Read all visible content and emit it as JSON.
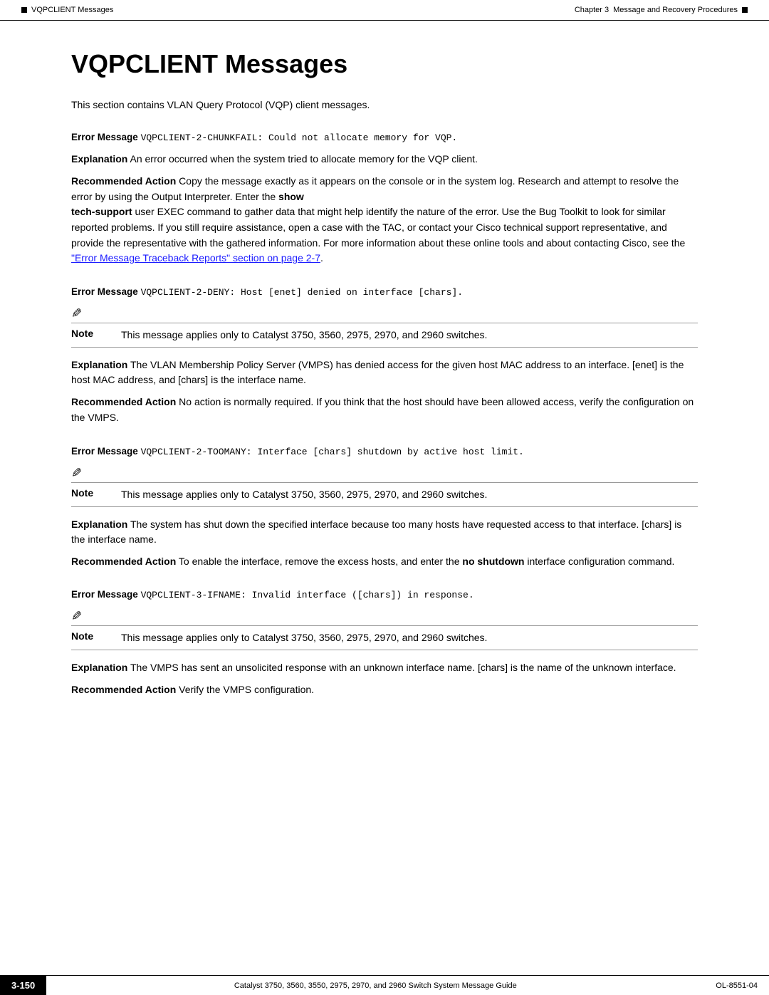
{
  "header": {
    "left_icon": "■",
    "left_label": "VQPCLIENT Messages",
    "chapter_label": "Chapter 3",
    "chapter_title": "Message and Recovery Procedures",
    "right_icon": "■"
  },
  "page_title": "VQPCLIENT Messages",
  "intro": "This section contains VLAN Query Protocol (VQP) client messages.",
  "sections": [
    {
      "id": "section1",
      "error_label": "Error Message",
      "error_code": "VQPCLIENT-2-CHUNKFAIL: Could not allocate memory for VQP.",
      "has_note": false,
      "explanation_label": "Explanation",
      "explanation_text": "An error occurred when the system tried to allocate memory for the VQP client.",
      "recommended_label": "Recommended Action",
      "recommended_text": "Copy the message exactly as it appears on the console or in the system log. Research and attempt to resolve the error by using the Output Interpreter. Enter the ",
      "recommended_bold1": "show",
      "recommended_text2": "",
      "recommended_bold2": "tech-support",
      "recommended_text3": " user EXEC command to gather data that might help identify the nature of the error. Use the Bug Toolkit to look for similar reported problems. If you still require assistance, open a case with the TAC, or contact your Cisco technical support representative, and provide the representative with the gathered information. For more information about these online tools and about contacting Cisco, see the ",
      "recommended_link": "\"Error Message Traceback Reports\" section on page 2-7",
      "recommended_text4": "."
    },
    {
      "id": "section2",
      "error_label": "Error Message",
      "error_code": "VQPCLIENT-2-DENY: Host [enet] denied on interface [chars].",
      "has_note": true,
      "note_text": "This message applies only to Catalyst 3750, 3560, 2975, 2970, and 2960 switches.",
      "explanation_label": "Explanation",
      "explanation_text": "The VLAN Membership Policy Server (VMPS) has denied access for the given host MAC address to an interface. [enet] is the host MAC address, and [chars] is the interface name.",
      "recommended_label": "Recommended Action",
      "recommended_text": "No action is normally required. If you think that the host should have been allowed access, verify the configuration on the VMPS."
    },
    {
      "id": "section3",
      "error_label": "Error Message",
      "error_code": "VQPCLIENT-2-TOOMANY: Interface [chars] shutdown by active host limit.",
      "has_note": true,
      "note_text": "This message applies only to Catalyst 3750, 3560, 2975, 2970, and 2960 switches.",
      "explanation_label": "Explanation",
      "explanation_text": "The system has shut down the specified interface because too many hosts have requested access to that interface. [chars] is the interface name.",
      "recommended_label": "Recommended Action",
      "recommended_text": "To enable the interface, remove the excess hosts, and enter the ",
      "recommended_bold": "no shutdown",
      "recommended_text2": " interface configuration command."
    },
    {
      "id": "section4",
      "error_label": "Error Message",
      "error_code": "VQPCLIENT-3-IFNAME: Invalid interface ([chars]) in response.",
      "has_note": true,
      "note_text": "This message applies only to Catalyst 3750, 3560, 2975, 2970, and 2960 switches.",
      "explanation_label": "Explanation",
      "explanation_text": "The VMPS has sent an unsolicited response with an unknown interface name. [chars] is the name of the unknown interface.",
      "recommended_label": "Recommended Action",
      "recommended_text": "Verify the VMPS configuration."
    }
  ],
  "footer": {
    "page_number": "3-150",
    "center_text": "Catalyst 3750, 3560, 3550, 2975, 2970, and 2960 Switch System Message Guide",
    "right_text": "OL-8551-04"
  }
}
